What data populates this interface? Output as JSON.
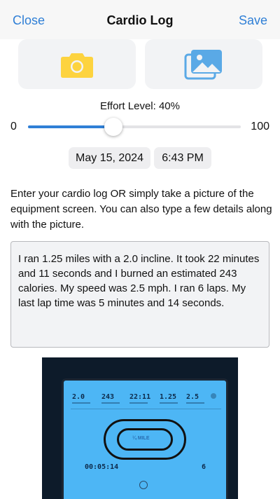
{
  "nav": {
    "close_label": "Close",
    "title": "Cardio Log",
    "save_label": "Save"
  },
  "media": {
    "camera_icon": "camera-icon",
    "gallery_icon": "photo-library-icon"
  },
  "effort": {
    "label": "Effort Level: 40%",
    "min": "0",
    "max": "100",
    "value_fraction": 0.4
  },
  "datetime": {
    "date": "May 15, 2024",
    "time": "6:43 PM"
  },
  "instructions": "Enter your cardio log OR simply take a picture of the equipment screen. You can also type a few details along with the picture.",
  "log_text": "I ran 1.25 miles with a 2.0 incline. It took 22 minutes and 11 seconds and I burned an estimated 243 calories. My speed was 2.5 mph. I ran 6 laps. My last lap time was 5 minutes and 14 seconds.",
  "photo": {
    "stats": [
      "2.0",
      "243",
      "22:11",
      "1.25",
      "2.5"
    ],
    "lap_time": "00:05:14",
    "laps": "6",
    "track_label": "¼ MILE"
  },
  "colors": {
    "accent": "#2f7fd6",
    "camera": "#fdd33f",
    "gallery": "#5aa9e6"
  }
}
